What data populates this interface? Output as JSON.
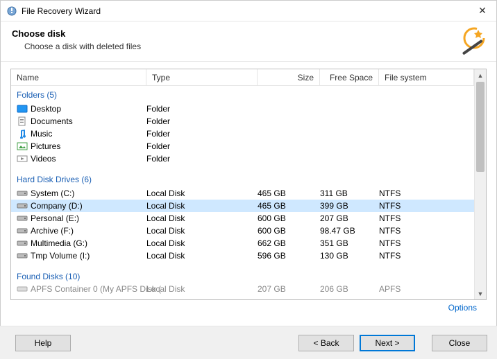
{
  "window": {
    "title": "File Recovery Wizard",
    "close_label": "✕"
  },
  "header": {
    "title": "Choose disk",
    "subtitle": "Choose a disk with deleted files"
  },
  "columns": {
    "name": "Name",
    "type": "Type",
    "size": "Size",
    "free": "Free Space",
    "fs": "File system"
  },
  "groups": {
    "folders": {
      "label": "Folders (5)"
    },
    "drives": {
      "label": "Hard Disk Drives (6)"
    },
    "found": {
      "label": "Found Disks (10)"
    }
  },
  "folders": [
    {
      "name": "Desktop",
      "type": "Folder"
    },
    {
      "name": "Documents",
      "type": "Folder"
    },
    {
      "name": "Music",
      "type": "Folder"
    },
    {
      "name": "Pictures",
      "type": "Folder"
    },
    {
      "name": "Videos",
      "type": "Folder"
    }
  ],
  "drives": [
    {
      "name": "System (C:)",
      "type": "Local Disk",
      "size": "465 GB",
      "free": "311 GB",
      "fs": "NTFS",
      "sel": false
    },
    {
      "name": "Company (D:)",
      "type": "Local Disk",
      "size": "465 GB",
      "free": "399 GB",
      "fs": "NTFS",
      "sel": true
    },
    {
      "name": "Personal (E:)",
      "type": "Local Disk",
      "size": "600 GB",
      "free": "207 GB",
      "fs": "NTFS",
      "sel": false
    },
    {
      "name": "Archive (F:)",
      "type": "Local Disk",
      "size": "600 GB",
      "free": "98.47 GB",
      "fs": "NTFS",
      "sel": false
    },
    {
      "name": "Multimedia (G:)",
      "type": "Local Disk",
      "size": "662 GB",
      "free": "351 GB",
      "fs": "NTFS",
      "sel": false
    },
    {
      "name": "Tmp Volume (I:)",
      "type": "Local Disk",
      "size": "596 GB",
      "free": "130 GB",
      "fs": "NTFS",
      "sel": false
    }
  ],
  "found_cutoff": {
    "name": "APFS Container 0 (My APFS Disk (",
    "type": "Local Disk",
    "size": "207 GB",
    "free": "206 GB",
    "fs": "APFS"
  },
  "links": {
    "options": "Options"
  },
  "buttons": {
    "help": "Help",
    "back": "< Back",
    "next": "Next >",
    "close": "Close"
  }
}
